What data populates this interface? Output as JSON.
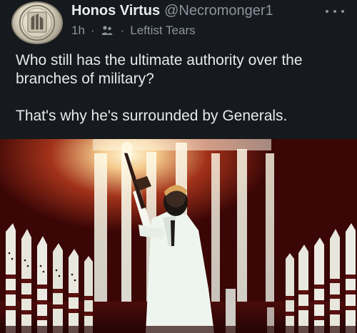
{
  "author": {
    "display_name": "Honos Virtus",
    "handle": "@Necromonger1",
    "avatar_icon": "coin-portrait-avatar"
  },
  "meta": {
    "time": "1h",
    "separator": "·",
    "community_icon": "community-globe-icon",
    "community": "Leftist Tears"
  },
  "tweet": {
    "line_1": "Who still has the ultimate authority over the branches of military?",
    "line_2": "That's why he's surrounded by Generals."
  },
  "media": {
    "description_colors": {
      "background": "#3a0606",
      "highlight": "#fff4d6",
      "figure": "#eef5ef"
    }
  },
  "actions": {
    "more_icon": "more-dots-icon"
  }
}
